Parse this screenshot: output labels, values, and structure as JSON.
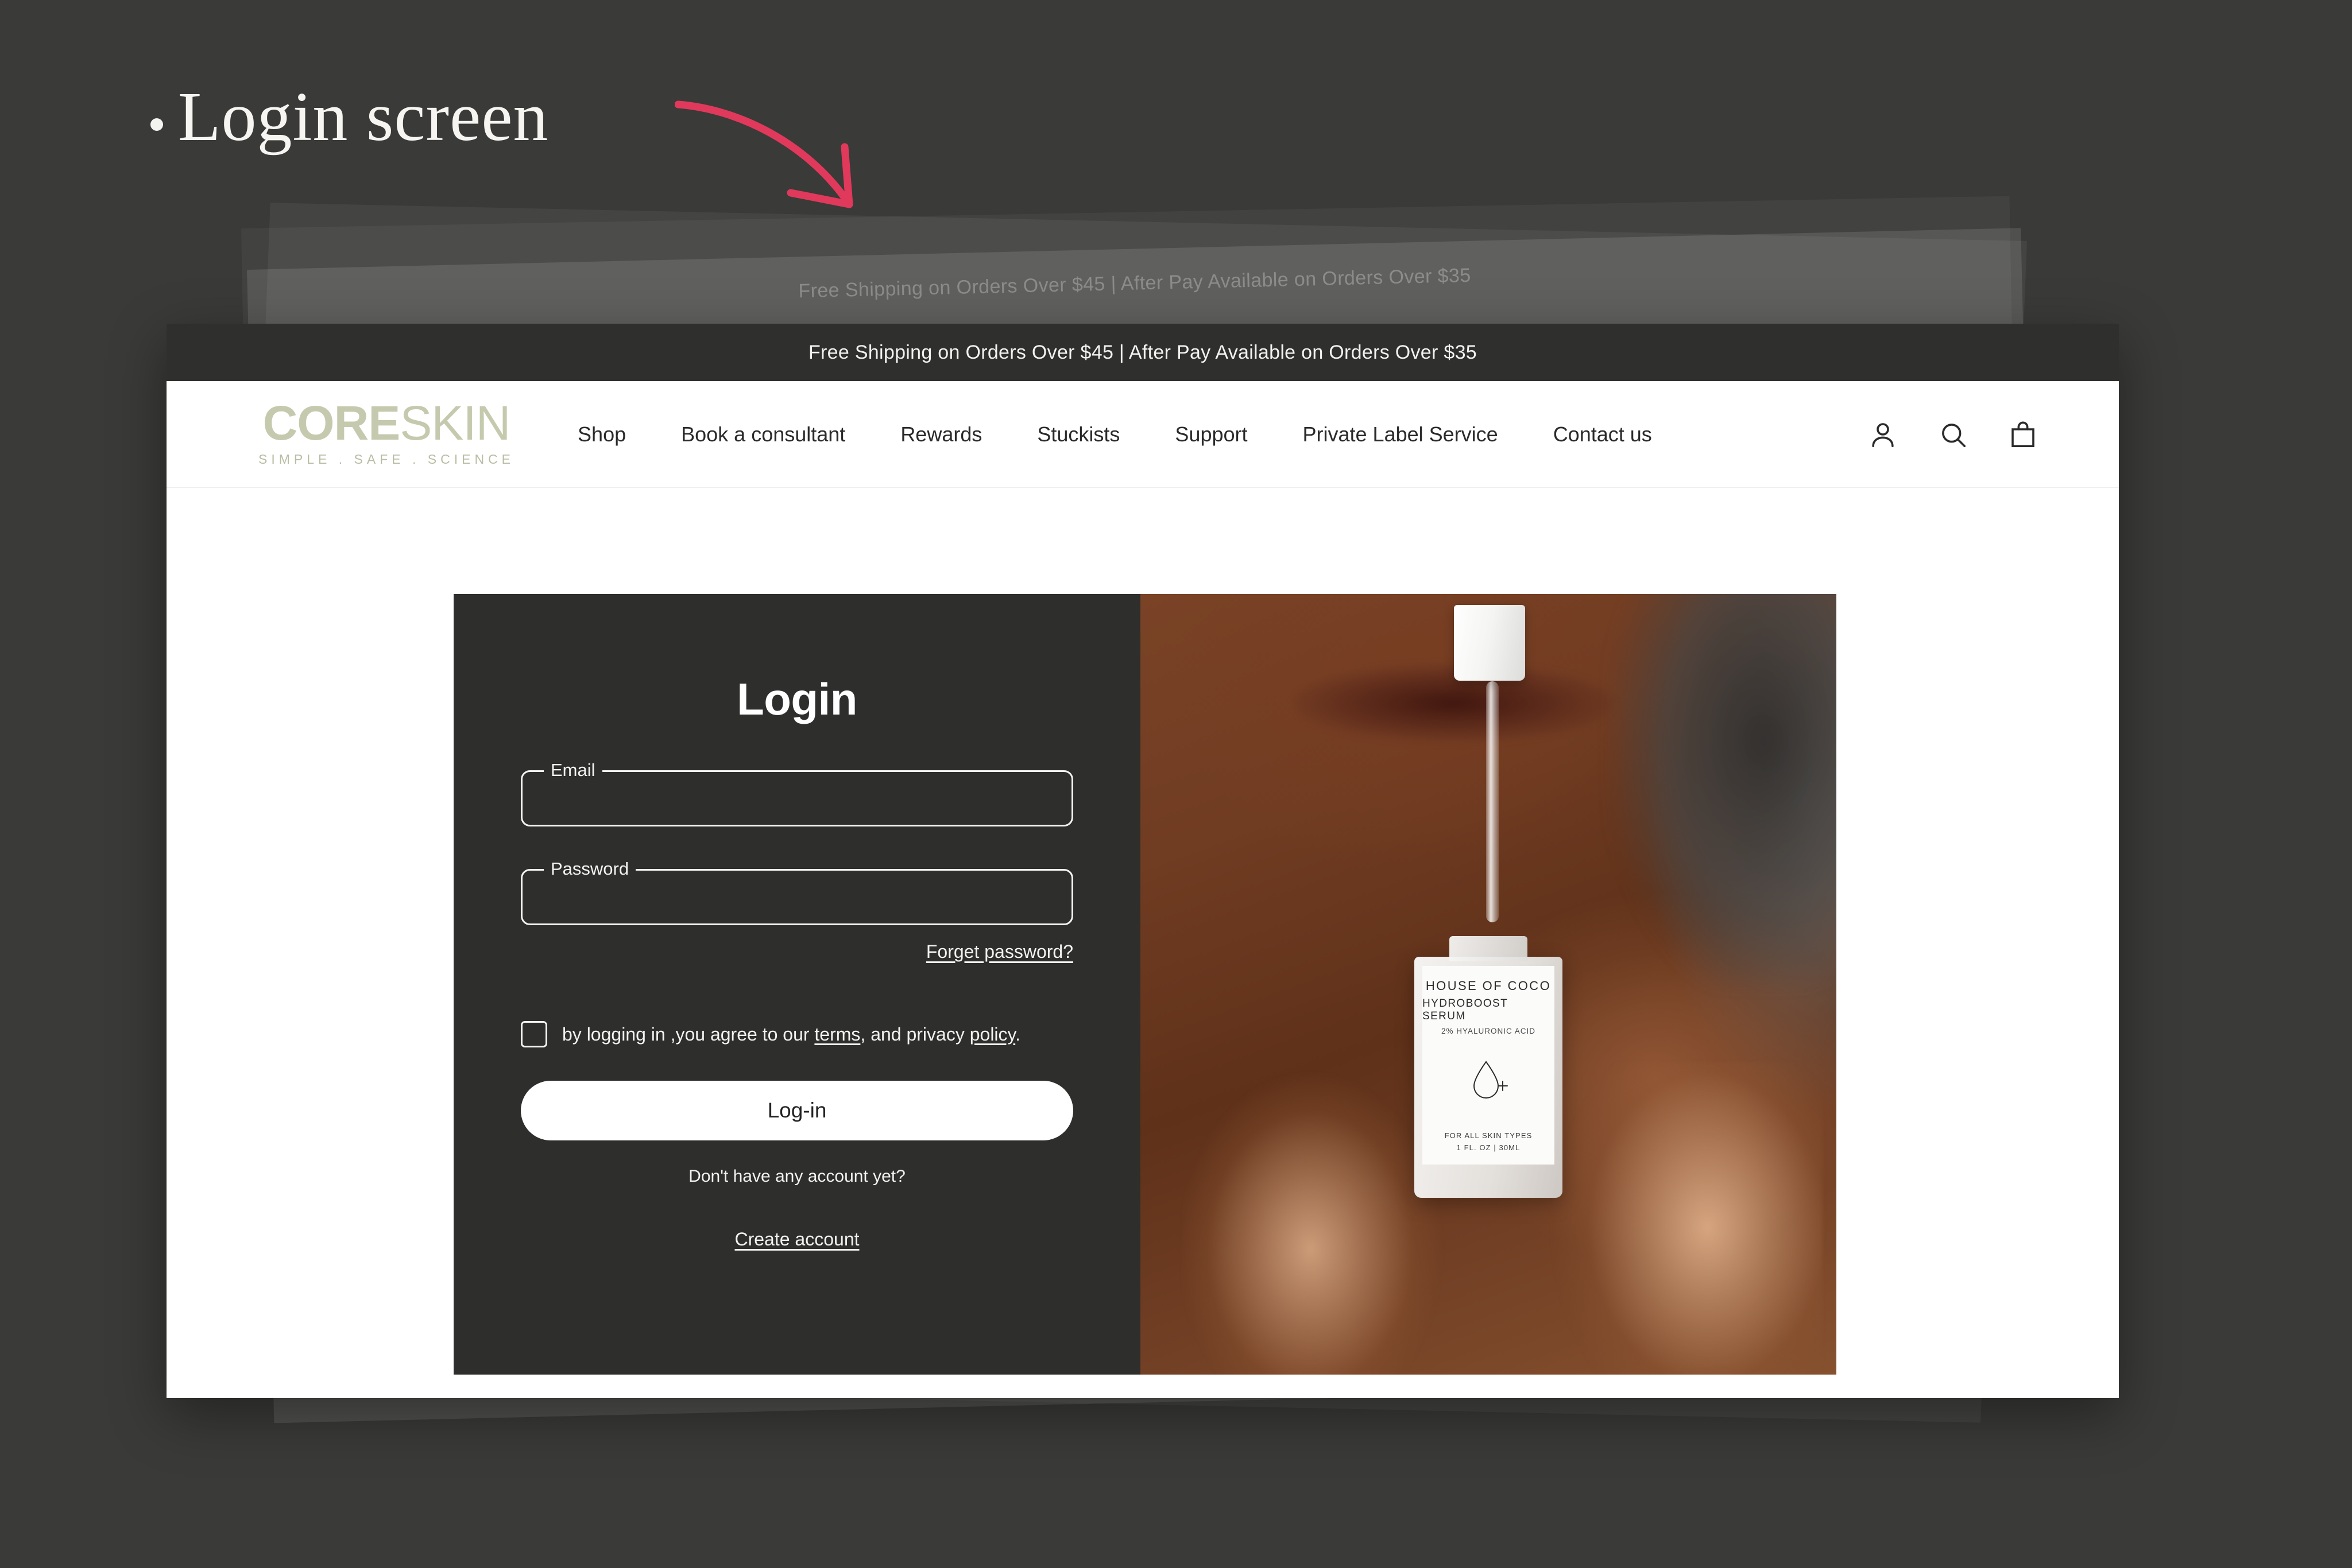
{
  "slide": {
    "bullet_title": "Login screen",
    "arrow_color": "#e0395b",
    "background_color": "#3a3a38"
  },
  "browser": {
    "announcement_bar": {
      "text": "Free Shipping on Orders Over $45 | After Pay Available on Orders Over $35",
      "background_color": "#2f2f2d"
    },
    "header": {
      "logo": {
        "word_bold": "CORE",
        "word_light": "SKIN",
        "tagline": "SIMPLE . SAFE . SCIENCE",
        "color": "#c5caae"
      },
      "nav_items": [
        {
          "label": "Shop"
        },
        {
          "label": "Book a consultant"
        },
        {
          "label": "Rewards"
        },
        {
          "label": "Stuckists"
        },
        {
          "label": "Support"
        },
        {
          "label": "Private Label Service"
        },
        {
          "label": "Contact us"
        }
      ],
      "icons": [
        {
          "name": "account-icon"
        },
        {
          "name": "search-icon"
        },
        {
          "name": "cart-icon"
        }
      ]
    }
  },
  "login": {
    "heading": "Login",
    "email_field": {
      "label": "Email",
      "value": "",
      "placeholder": ""
    },
    "password_field": {
      "label": "Password",
      "value": "",
      "placeholder": ""
    },
    "forgot_link": "Forget password?",
    "terms": {
      "prefix": "by logging in ,you agree to our ",
      "terms_link": "terms",
      "middle": ", and privacy ",
      "policy_link": "policy",
      "suffix": ".",
      "checked": false
    },
    "submit_button": "Log-in",
    "no_account_text": "Don't have any account yet?",
    "create_account_link": "Create account",
    "panel_color": "#2e2e2c"
  },
  "product_photo": {
    "alt": "Woman holding serum bottle with dropper",
    "bottle_label": {
      "brand": "HOUSE OF COCO",
      "product": "HYDROBOOST SERUM",
      "active": "2% HYALURONIC ACID",
      "skin_types": "FOR ALL SKIN TYPES",
      "size": "1 FL. OZ  |  30ML"
    }
  }
}
